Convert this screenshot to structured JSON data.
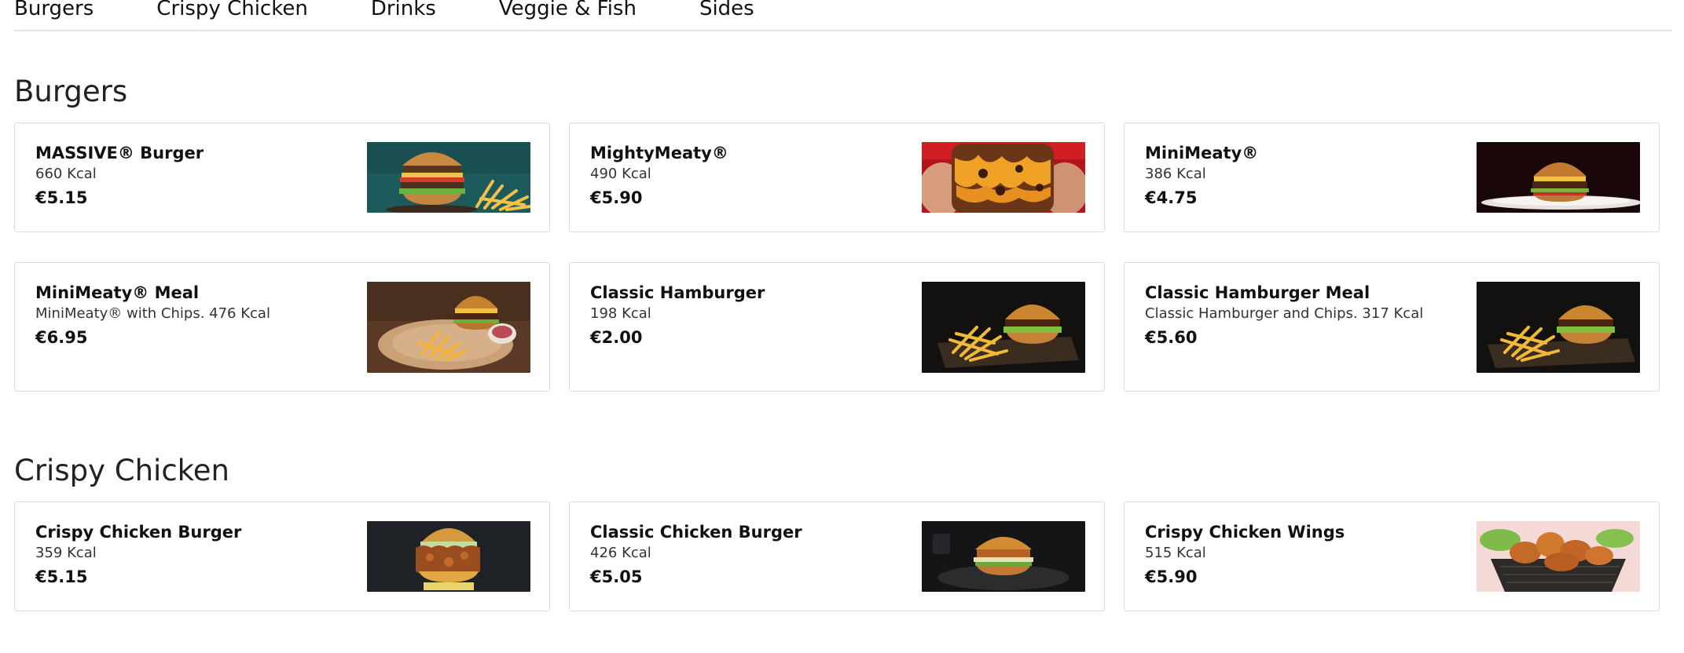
{
  "nav": {
    "tabs": [
      "Burgers",
      "Crispy Chicken",
      "Drinks",
      "Veggie & Fish",
      "Sides"
    ]
  },
  "sections": [
    {
      "title": "Burgers",
      "items": [
        {
          "name": "MASSIVE® Burger",
          "desc": "660 Kcal",
          "price": "€5.15",
          "image": "burger-fries-teal-photo"
        },
        {
          "name": "MightyMeaty®",
          "desc": "490 Kcal",
          "price": "€5.90",
          "image": "cheesy-burger-hands-photo"
        },
        {
          "name": "MiniMeaty®",
          "desc": "386 Kcal",
          "price": "€4.75",
          "image": "burger-plate-dark-photo"
        },
        {
          "name": "MiniMeaty® Meal",
          "desc": "MiniMeaty® with Chips. 476 Kcal",
          "price": "€6.95",
          "image": "burger-meal-board-photo"
        },
        {
          "name": "Classic Hamburger",
          "desc": "198 Kcal",
          "price": "€2.00",
          "image": "burger-fries-tray-photo"
        },
        {
          "name": "Classic Hamburger Meal",
          "desc": "Classic Hamburger and Chips. 317 Kcal",
          "price": "€5.60",
          "image": "burger-fries-tray-photo"
        }
      ]
    },
    {
      "title": "Crispy Chicken",
      "items": [
        {
          "name": "Crispy Chicken Burger",
          "desc": "359 Kcal",
          "price": "€5.15",
          "image": "crispy-chicken-burger-photo"
        },
        {
          "name": "Classic Chicken Burger",
          "desc": "426 Kcal",
          "price": "€5.05",
          "image": "chicken-burger-plate-photo"
        },
        {
          "name": "Crispy Chicken Wings",
          "desc": "515 Kcal",
          "price": "€5.90",
          "image": "chicken-wings-basket-photo"
        }
      ]
    }
  ]
}
